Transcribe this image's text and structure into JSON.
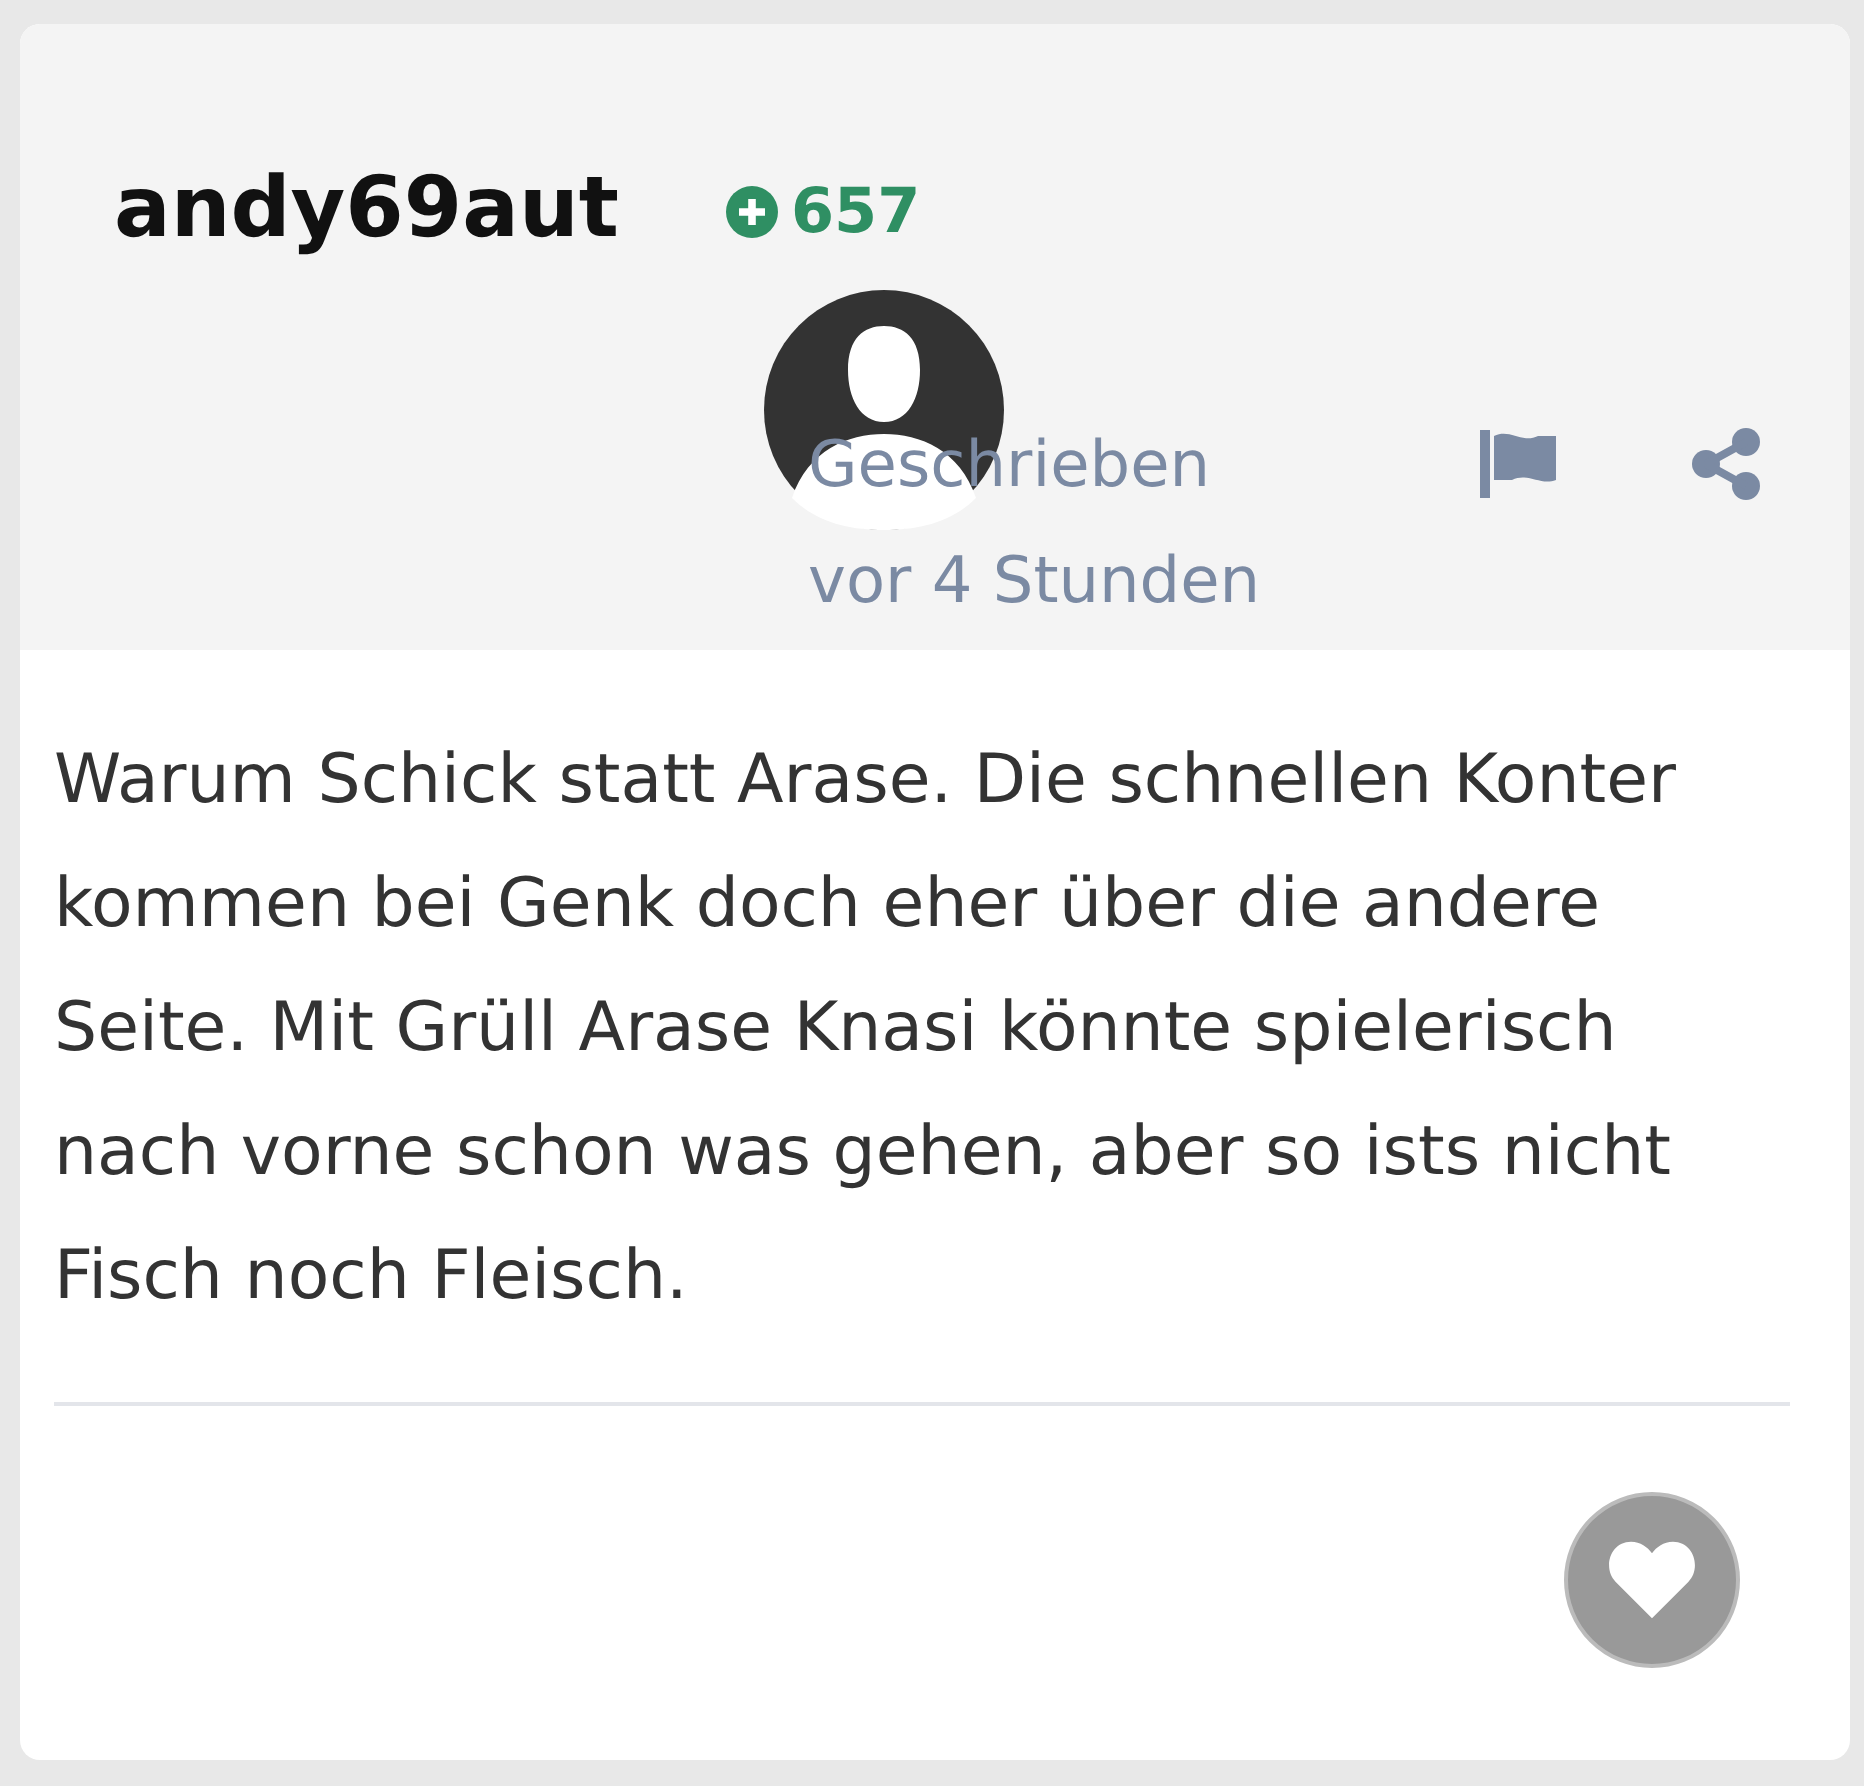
{
  "post": {
    "author": "andy69aut",
    "reputation": "657",
    "posted": "Geschrieben vor 4 Stunden",
    "body": "Warum Schick statt Arase. Die schnellen Konter kommen bei Genk doch eher über die andere Seite. Mit Grüll Arase Knasi könnte spielerisch nach vorne schon was gehen, aber so ists nicht Fisch noch Fleisch."
  }
}
